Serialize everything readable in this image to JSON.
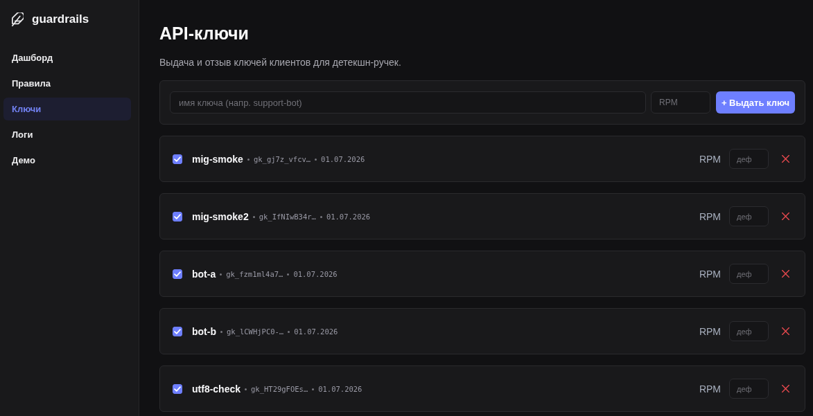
{
  "sidebar": {
    "logo": {
      "text": "guardrails"
    },
    "items": [
      {
        "label": "Дашборд",
        "selected": false
      },
      {
        "label": "Правила",
        "selected": false
      },
      {
        "label": "Ключи",
        "selected": true
      },
      {
        "label": "Логи",
        "selected": false
      },
      {
        "label": "Демо",
        "selected": false
      }
    ]
  },
  "page": {
    "title": "API-ключи",
    "subtitle": "Выдача и отзыв ключей клиентов для детекшн-ручек."
  },
  "create_form": {
    "name_field": {
      "placeholder": "имя ключа (напр. support-bot)"
    },
    "rpm_field": {
      "placeholder": "RPM"
    },
    "submit_button": {
      "label": "+ Выдать ключ"
    }
  },
  "keys": [
    {
      "checked": true,
      "name": "mig-smoke",
      "key": "gk_gj7z_vfcv…",
      "created": "01.07.2026",
      "rpm_label": "RPM",
      "rpm_field": {
        "placeholder": "деф"
      }
    },
    {
      "checked": true,
      "name": "mig-smoke2",
      "key": "gk_IfNIwB34r…",
      "created": "01.07.2026",
      "rpm_label": "RPM",
      "rpm_field": {
        "placeholder": "деф"
      }
    },
    {
      "checked": true,
      "name": "bot-a",
      "key": "gk_fzm1ml4a7…",
      "created": "01.07.2026",
      "rpm_label": "RPM",
      "rpm_field": {
        "placeholder": "деф"
      }
    },
    {
      "checked": true,
      "name": "bot-b",
      "key": "gk_lCWHjPC0-…",
      "created": "01.07.2026",
      "rpm_label": "RPM",
      "rpm_field": {
        "placeholder": "деф"
      }
    },
    {
      "checked": true,
      "name": "utf8-check",
      "key": "gk_HT29gFOEs…",
      "created": "01.07.2026",
      "rpm_label": "RPM",
      "rpm_field": {
        "placeholder": "деф"
      }
    }
  ]
}
